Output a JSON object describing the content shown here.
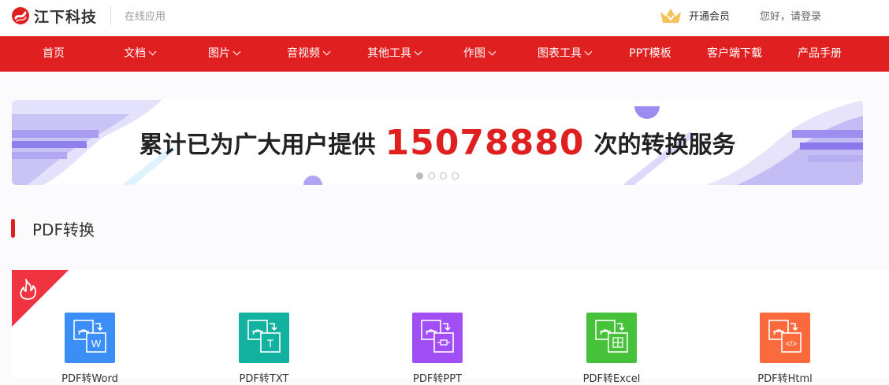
{
  "header": {
    "logo_text": "江下科技",
    "subtitle": "在线应用",
    "vip_label": "开通会员",
    "login_label": "您好，请登录",
    "brand_color": "#e02020"
  },
  "nav": {
    "items": [
      {
        "label": "首页",
        "dropdown": false
      },
      {
        "label": "文档",
        "dropdown": true
      },
      {
        "label": "图片",
        "dropdown": true
      },
      {
        "label": "音视频",
        "dropdown": true
      },
      {
        "label": "其他工具",
        "dropdown": true
      },
      {
        "label": "作图",
        "dropdown": true
      },
      {
        "label": "图表工具",
        "dropdown": true
      },
      {
        "label": "PPT模板",
        "dropdown": false
      },
      {
        "label": "客户端下载",
        "dropdown": false
      },
      {
        "label": "产品手册",
        "dropdown": false
      }
    ]
  },
  "banner": {
    "text_before": "累计已为广大用户提供",
    "count": "15078880",
    "text_after": "次的转换服务",
    "slide_count": 4,
    "active_slide": 1
  },
  "section": {
    "title": "PDF转换"
  },
  "tools": [
    {
      "label": "PDF转Word",
      "color": "#3a8ef6",
      "icon": "word-doc-icon",
      "glyph": "W"
    },
    {
      "label": "PDF转TXT",
      "color": "#13b1a0",
      "icon": "txt-doc-icon",
      "glyph": "T"
    },
    {
      "label": "PDF转PPT",
      "color": "#a24ef5",
      "icon": "ppt-doc-icon",
      "glyph": ""
    },
    {
      "label": "PDF转Excel",
      "color": "#45c13a",
      "icon": "excel-doc-icon",
      "glyph": ""
    },
    {
      "label": "PDF转Html",
      "color": "#fa6a3c",
      "icon": "html-doc-icon",
      "glyph": "</>"
    }
  ]
}
